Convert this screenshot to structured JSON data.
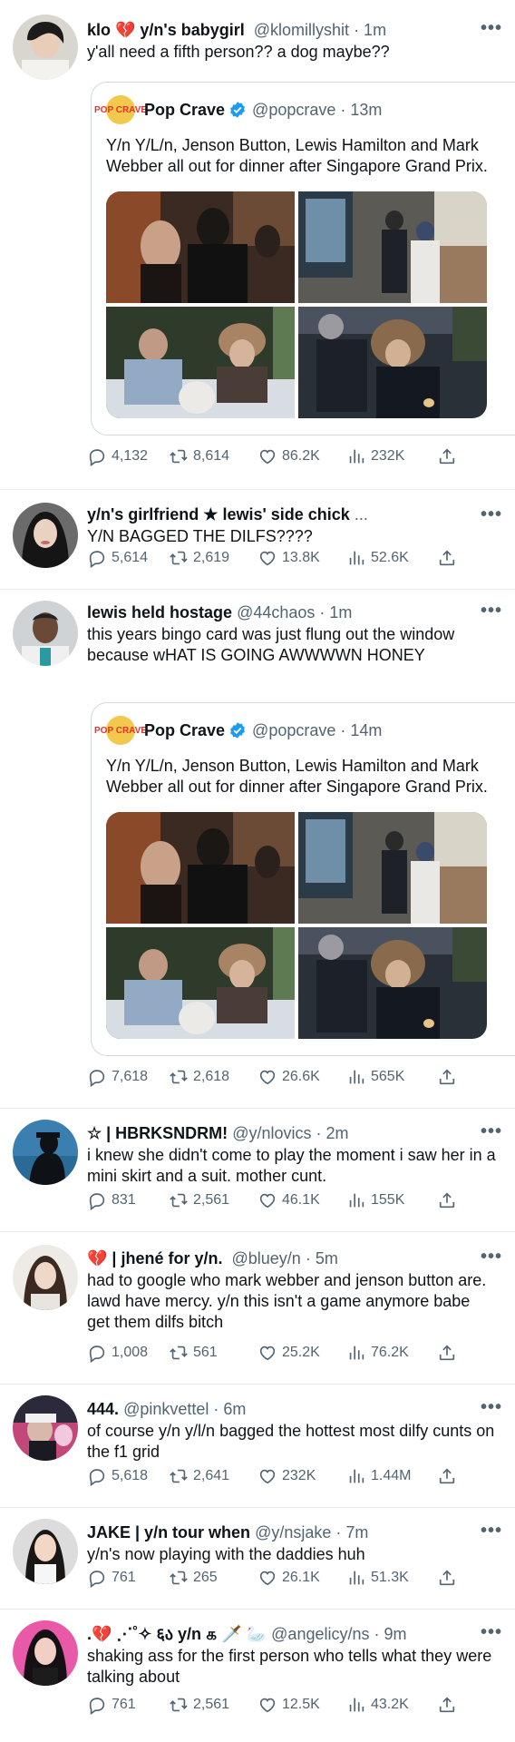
{
  "icons": {
    "reply": "reply-icon",
    "retweet": "retweet-icon",
    "like": "heart-icon",
    "views": "views-chart-icon",
    "share": "share-icon",
    "more": "more-dots-icon",
    "verified": "verified-badge-icon"
  },
  "colors": {
    "muted": "#536471",
    "verified": "#1d9bf0",
    "divider": "#e6ecf0"
  },
  "quote": {
    "name": "Pop Crave",
    "logo_text": "POP CRAVE",
    "handle": "@popcrave",
    "text": "Y/n Y/L/n, Jenson Button, Lewis Hamilton and Mark Webber all out for dinner after Singapore Grand Prix."
  },
  "tweets": [
    {
      "name": "klo 💔  y/n's babygirl",
      "handle": "@klomillyshit",
      "time": "· 1m",
      "text": "y'all need a fifth person?? a dog maybe??",
      "quote_time": "· 13m",
      "stats": {
        "reply": "4,132",
        "retweet": "8,614",
        "like": "86.2K",
        "views": "232K"
      }
    },
    {
      "name": "y/n's girlfriend ★ lewis' side chick",
      "handle": "...",
      "time": "",
      "text": "Y/N BAGGED THE DILFS????",
      "stats": {
        "reply": "5,614",
        "retweet": "2,619",
        "like": "13.8K",
        "views": "52.6K"
      }
    },
    {
      "name": "lewis held hostage",
      "handle": "@44chaos",
      "time": "· 1m",
      "text": "this years bingo card was just flung out the window because wHAT IS GOING AWWWWN HONEY",
      "quote_time": "· 14m",
      "stats": {
        "reply": "7,618",
        "retweet": "2,618",
        "like": "26.6K",
        "views": "565K"
      }
    },
    {
      "name": "☆ | HBRKSNDRM!",
      "handle": "@y/nlovics",
      "time": "· 2m",
      "text": "i knew she didn't come to play the moment i saw her in a mini skirt and a suit. mother cunt.",
      "stats": {
        "reply": "831",
        "retweet": "2,561",
        "like": "46.1K",
        "views": "155K"
      }
    },
    {
      "name": "💔 | jhené for y/n.",
      "handle": "@bluey/n",
      "time": "· 5m",
      "text": "had to google who mark webber and jenson button are. lawd have mercy. y/n this isn't a game anymore babe get them dilfs bitch",
      "stats": {
        "reply": "1,008",
        "retweet": "561",
        "like": "25.2K",
        "views": "76.2K"
      }
    },
    {
      "name": "444.",
      "handle": "@pinkvettel",
      "time": "· 6m",
      "text": "of course y/n y/l/n bagged the hottest most dilfy cunts on the f1 grid",
      "stats": {
        "reply": "5,618",
        "retweet": "2,641",
        "like": "232K",
        "views": "1.44M"
      }
    },
    {
      "name": "JAKE | y/n tour when",
      "handle": "@y/nsjake",
      "time": "· 7m",
      "text": "y/n's now playing with the daddies huh",
      "stats": {
        "reply": "761",
        "retweet": "265",
        "like": "26.1K",
        "views": "51.3K"
      }
    },
    {
      "name": ".💔 ⋰˚✧ ६ა y/n ௧ 🗡️ 🦢",
      "handle": "@angelicy/ns",
      "time": "· 9m",
      "text": "shaking ass for the first person who tells what they were talking about",
      "stats": {
        "reply": "761",
        "retweet": "2,561",
        "like": "12.5K",
        "views": "43.2K"
      }
    }
  ]
}
